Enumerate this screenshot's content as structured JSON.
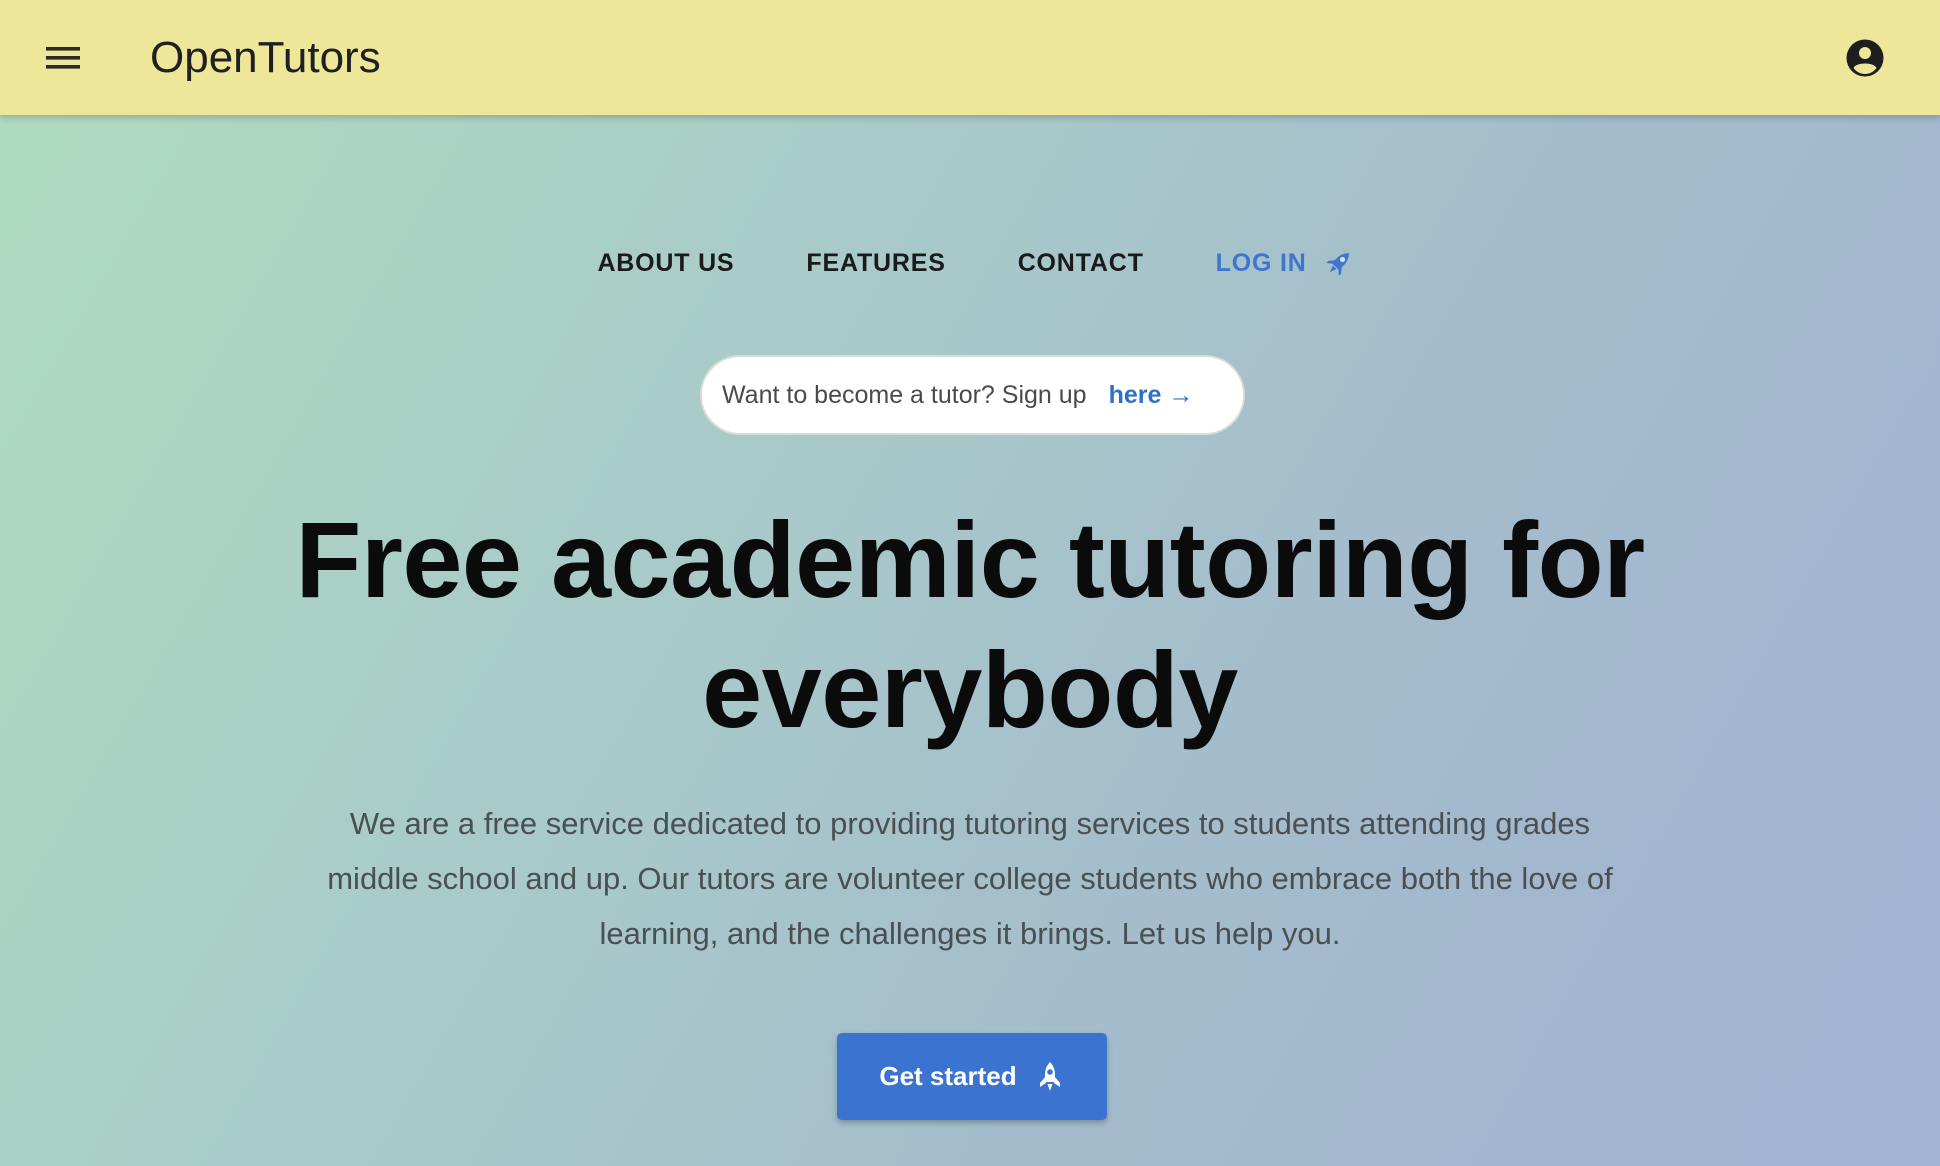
{
  "appbar": {
    "title": "OpenTutors",
    "menu_icon": "menu-icon",
    "account_icon": "account-circle-icon",
    "background": "#eee799"
  },
  "nav": {
    "items": [
      {
        "label": "ABOUT US"
      },
      {
        "label": "FEATURES"
      },
      {
        "label": "CONTACT"
      },
      {
        "label": "LOG IN",
        "icon": "rocket-icon",
        "color": "#3e76cf"
      }
    ]
  },
  "signup_banner": {
    "text": "Want to become a tutor? Sign up",
    "link_label": "here →"
  },
  "hero": {
    "headline_line1": "Free academic tutoring for",
    "headline_line2": "everybody",
    "description_line1": "We are a free service dedicated to providing tutoring services to students attending grades",
    "description_line2": "middle school and up. Our tutors are volunteer college students who embrace both the love of",
    "description_line3": "learning, and the challenges it brings. Let us help you."
  },
  "cta": {
    "label": "Get started",
    "icon": "rocket-icon",
    "color": "#3a74d0"
  }
}
